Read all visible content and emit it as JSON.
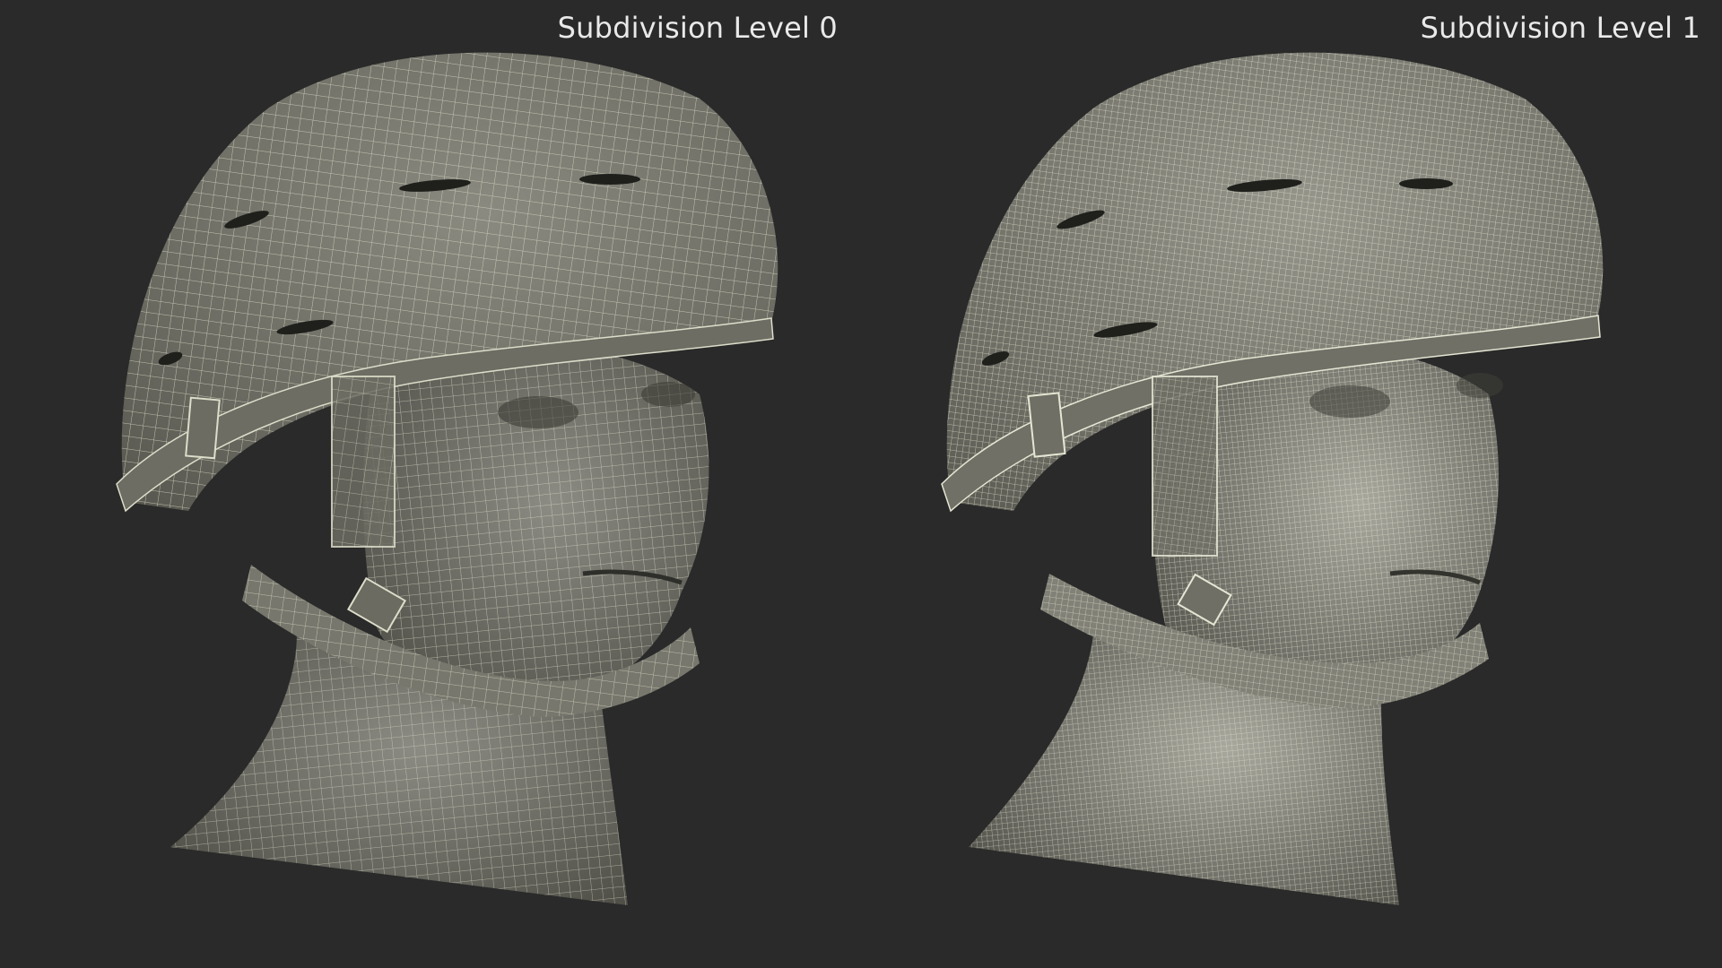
{
  "panels": [
    {
      "label": "Subdivision Level 0"
    },
    {
      "label": "Subdivision Level 1"
    }
  ],
  "colors": {
    "background": "#2a2a2a",
    "mesh_fill": "#7d7d74",
    "wire_color": "#e6e6d4",
    "label_color": "#e9e9e9"
  }
}
